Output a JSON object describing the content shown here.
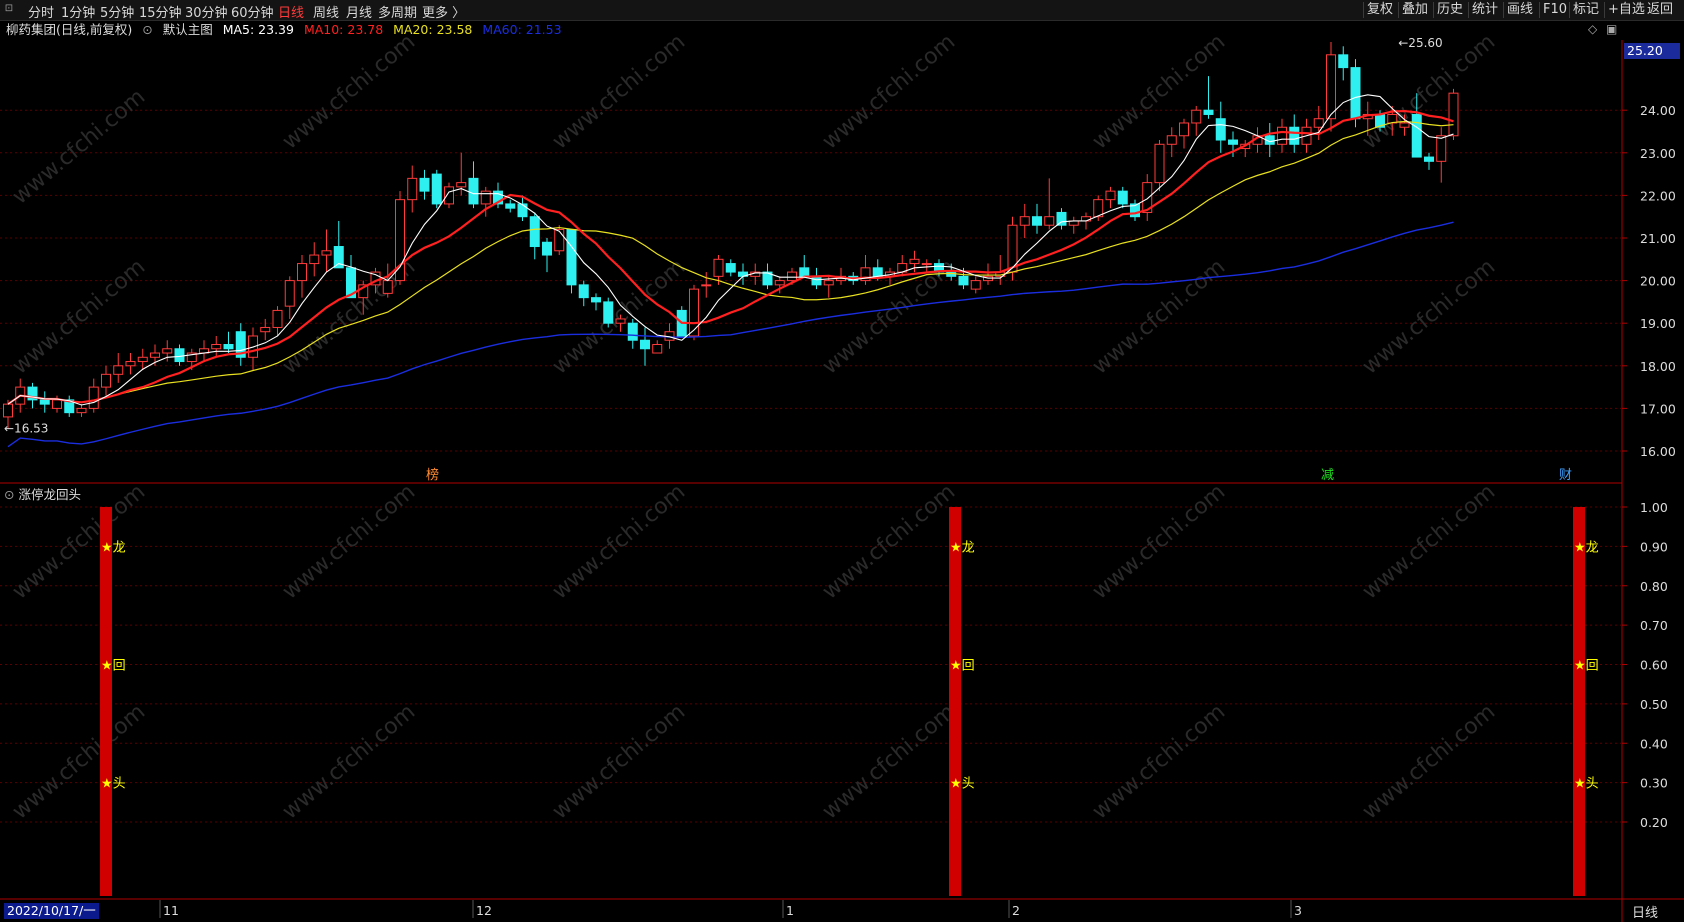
{
  "toolbar": {
    "left": [
      "分时",
      "1分钟",
      "5分钟",
      "15分钟",
      "30分钟",
      "60分钟",
      "日线",
      "周线",
      "月线",
      "多周期",
      "更多 〉"
    ],
    "active": "日线",
    "right": [
      "复权",
      "叠加",
      "历史",
      "统计",
      "画线",
      "F10",
      "标记",
      "+自选",
      "返回"
    ]
  },
  "info": {
    "title": "柳药集团(日线,前复权)",
    "template": "默认主图",
    "ma5": "MA5: 23.39",
    "ma10": "MA10: 23.78",
    "ma20": "MA20: 23.58",
    "ma60": "MA60: 21.53"
  },
  "colors": {
    "ma5": "#ffffff",
    "ma10": "#ff2020",
    "ma20": "#e8e020",
    "ma60": "#1a2ee0",
    "up": "#ff3b3b",
    "down": "#2ef0f0",
    "grid": "#5a0000",
    "signal_bar": "#d10000",
    "marker": "#ffff00"
  },
  "main_axis": {
    "ticks": [
      "16.00",
      "17.00",
      "18.00",
      "19.00",
      "20.00",
      "21.00",
      "22.00",
      "23.00",
      "24.00"
    ],
    "current_price": "25.20",
    "high_label": "25.60",
    "low_label": "16.53"
  },
  "events": [
    "榜",
    "减",
    "财"
  ],
  "indicator": {
    "name": "涨停龙回头",
    "ticks": [
      "0.20",
      "0.30",
      "0.40",
      "0.50",
      "0.60",
      "0.70",
      "0.80",
      "0.90",
      "1.00"
    ],
    "markers": [
      "★龙",
      "★回",
      "★头"
    ]
  },
  "timeline": {
    "date": "2022/10/17/一",
    "months": [
      "11",
      "12",
      "1",
      "2",
      "3"
    ],
    "period": "日线"
  },
  "watermark": "www.cfchi.com",
  "chart_data": {
    "type": "candlestick",
    "ylim": [
      15.6,
      25.9
    ],
    "candles": [
      [
        16.8,
        17.2,
        16.53,
        17.1
      ],
      [
        17.1,
        17.7,
        16.9,
        17.5
      ],
      [
        17.5,
        17.6,
        17.0,
        17.2
      ],
      [
        17.2,
        17.4,
        16.9,
        17.1
      ],
      [
        17.0,
        17.3,
        16.9,
        17.2
      ],
      [
        17.2,
        17.3,
        16.8,
        16.9
      ],
      [
        16.9,
        17.1,
        16.8,
        17.0
      ],
      [
        17.0,
        17.7,
        16.9,
        17.5
      ],
      [
        17.5,
        18.0,
        17.3,
        17.8
      ],
      [
        17.8,
        18.3,
        17.6,
        18.0
      ],
      [
        18.0,
        18.3,
        17.8,
        18.1
      ],
      [
        18.1,
        18.4,
        17.9,
        18.2
      ],
      [
        18.2,
        18.5,
        18.0,
        18.3
      ],
      [
        18.3,
        18.6,
        18.1,
        18.4
      ],
      [
        18.4,
        18.5,
        18.0,
        18.1
      ],
      [
        18.1,
        18.4,
        17.9,
        18.3
      ],
      [
        18.3,
        18.6,
        18.1,
        18.4
      ],
      [
        18.4,
        18.7,
        18.2,
        18.5
      ],
      [
        18.5,
        18.8,
        18.3,
        18.4
      ],
      [
        18.8,
        19.0,
        18.0,
        18.2
      ],
      [
        18.2,
        18.9,
        17.9,
        18.7
      ],
      [
        18.8,
        19.1,
        18.6,
        18.9
      ],
      [
        18.9,
        19.4,
        18.7,
        19.3
      ],
      [
        19.4,
        20.1,
        19.1,
        20.0
      ],
      [
        20.0,
        20.6,
        19.6,
        20.4
      ],
      [
        20.4,
        20.9,
        20.1,
        20.6
      ],
      [
        20.6,
        21.2,
        20.2,
        20.7
      ],
      [
        20.8,
        21.4,
        20.3,
        20.3
      ],
      [
        20.3,
        20.6,
        19.6,
        19.6
      ],
      [
        19.6,
        20.0,
        19.2,
        19.9
      ],
      [
        19.9,
        20.3,
        19.7,
        20.2
      ],
      [
        19.7,
        20.4,
        19.6,
        20.0
      ],
      [
        20.0,
        22.1,
        19.9,
        21.9
      ],
      [
        21.9,
        22.7,
        21.6,
        22.4
      ],
      [
        22.4,
        22.6,
        21.9,
        22.1
      ],
      [
        22.5,
        22.6,
        21.7,
        21.8
      ],
      [
        21.8,
        22.3,
        21.7,
        22.2
      ],
      [
        22.2,
        23.0,
        22.0,
        22.3
      ],
      [
        22.4,
        22.8,
        21.7,
        21.8
      ],
      [
        21.8,
        22.2,
        21.5,
        22.1
      ],
      [
        22.1,
        22.3,
        21.7,
        21.8
      ],
      [
        21.8,
        21.9,
        21.6,
        21.7
      ],
      [
        21.8,
        22.0,
        21.4,
        21.5
      ],
      [
        21.5,
        21.6,
        20.5,
        20.8
      ],
      [
        20.9,
        21.0,
        20.2,
        20.6
      ],
      [
        20.7,
        21.3,
        20.6,
        21.2
      ],
      [
        21.2,
        21.2,
        19.7,
        19.9
      ],
      [
        19.9,
        20.0,
        19.4,
        19.6
      ],
      [
        19.6,
        19.7,
        19.3,
        19.5
      ],
      [
        19.5,
        19.6,
        18.9,
        19.0
      ],
      [
        19.0,
        19.2,
        18.8,
        19.1
      ],
      [
        19.0,
        19.1,
        18.4,
        18.6
      ],
      [
        18.6,
        18.9,
        18.0,
        18.4
      ],
      [
        18.3,
        18.6,
        18.3,
        18.5
      ],
      [
        18.6,
        19.0,
        18.4,
        18.8
      ],
      [
        19.3,
        19.4,
        18.7,
        18.7
      ],
      [
        18.7,
        19.9,
        18.6,
        19.8
      ],
      [
        19.9,
        20.2,
        19.6,
        19.9
      ],
      [
        20.1,
        20.6,
        19.9,
        20.5
      ],
      [
        20.4,
        20.5,
        20.1,
        20.2
      ],
      [
        20.2,
        20.4,
        19.9,
        20.1
      ],
      [
        20.1,
        20.4,
        19.9,
        20.2
      ],
      [
        20.2,
        20.4,
        19.8,
        19.9
      ],
      [
        19.9,
        20.1,
        19.7,
        20.0
      ],
      [
        20.0,
        20.3,
        19.9,
        20.2
      ],
      [
        20.3,
        20.6,
        20.1,
        20.1
      ],
      [
        20.1,
        20.3,
        19.8,
        19.9
      ],
      [
        19.9,
        20.1,
        19.6,
        20.0
      ],
      [
        20.0,
        20.3,
        19.9,
        20.1
      ],
      [
        20.1,
        20.2,
        19.9,
        20.0
      ],
      [
        20.0,
        20.6,
        19.9,
        20.3
      ],
      [
        20.3,
        20.5,
        20.0,
        20.1
      ],
      [
        20.1,
        20.3,
        19.9,
        20.2
      ],
      [
        20.2,
        20.6,
        20.1,
        20.4
      ],
      [
        20.4,
        20.7,
        20.2,
        20.5
      ],
      [
        20.4,
        20.5,
        20.2,
        20.4
      ],
      [
        20.4,
        20.5,
        20.1,
        20.2
      ],
      [
        20.2,
        20.4,
        20.0,
        20.1
      ],
      [
        20.1,
        20.3,
        19.8,
        19.9
      ],
      [
        19.8,
        20.1,
        19.7,
        20.0
      ],
      [
        20.0,
        20.4,
        19.9,
        20.1
      ],
      [
        20.1,
        20.6,
        19.9,
        20.2
      ],
      [
        20.2,
        21.5,
        20.0,
        21.3
      ],
      [
        21.3,
        21.8,
        21.0,
        21.5
      ],
      [
        21.5,
        21.8,
        21.1,
        21.3
      ],
      [
        21.3,
        22.4,
        21.2,
        21.5
      ],
      [
        21.6,
        21.7,
        21.2,
        21.3
      ],
      [
        21.3,
        21.5,
        21.1,
        21.4
      ],
      [
        21.4,
        21.6,
        21.2,
        21.5
      ],
      [
        21.5,
        22.0,
        21.4,
        21.9
      ],
      [
        21.9,
        22.2,
        21.7,
        22.1
      ],
      [
        22.1,
        22.2,
        21.7,
        21.8
      ],
      [
        21.8,
        21.9,
        21.4,
        21.5
      ],
      [
        21.6,
        22.5,
        21.4,
        22.3
      ],
      [
        22.3,
        23.3,
        22.1,
        23.2
      ],
      [
        23.2,
        23.6,
        22.9,
        23.4
      ],
      [
        23.4,
        23.8,
        23.1,
        23.7
      ],
      [
        23.7,
        24.1,
        23.4,
        24.0
      ],
      [
        24.0,
        24.8,
        23.8,
        23.9
      ],
      [
        23.8,
        24.2,
        23.0,
        23.3
      ],
      [
        23.3,
        23.5,
        22.9,
        23.2
      ],
      [
        23.1,
        23.3,
        22.9,
        23.2
      ],
      [
        23.2,
        23.6,
        23.0,
        23.4
      ],
      [
        23.4,
        23.7,
        22.9,
        23.2
      ],
      [
        23.2,
        23.8,
        23.0,
        23.6
      ],
      [
        23.6,
        23.9,
        23.0,
        23.2
      ],
      [
        23.2,
        23.8,
        23.0,
        23.6
      ],
      [
        23.6,
        24.1,
        23.3,
        23.8
      ],
      [
        23.8,
        25.6,
        23.5,
        25.3
      ],
      [
        25.3,
        25.5,
        24.7,
        25.0
      ],
      [
        25.0,
        25.2,
        23.6,
        23.8
      ],
      [
        23.8,
        24.2,
        23.4,
        23.9
      ],
      [
        23.9,
        24.0,
        23.5,
        23.6
      ],
      [
        23.7,
        24.1,
        23.4,
        23.9
      ],
      [
        23.6,
        23.9,
        23.4,
        23.7
      ],
      [
        23.9,
        24.4,
        22.9,
        22.9
      ],
      [
        22.9,
        23.0,
        22.6,
        22.8
      ],
      [
        22.8,
        23.6,
        22.3,
        23.4
      ],
      [
        23.4,
        24.5,
        23.3,
        24.4
      ]
    ],
    "indicator_signals": [
      14,
      74,
      122
    ]
  }
}
